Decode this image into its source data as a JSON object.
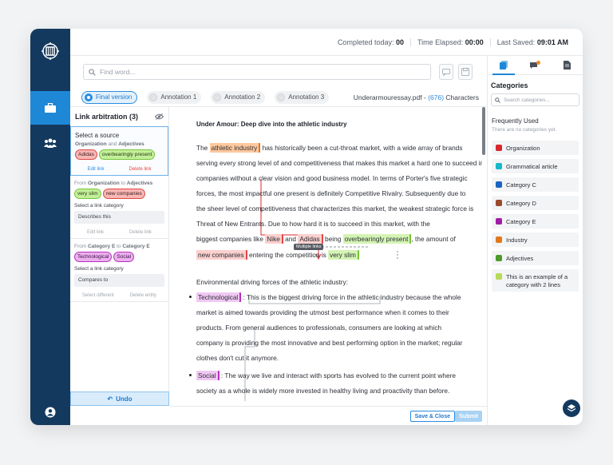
{
  "header": {
    "completed_label": "Completed today:",
    "completed_value": "00",
    "elapsed_label": "Time Elapsed:",
    "elapsed_value": "00:00",
    "saved_label": "Last Saved:",
    "saved_value": "09:01 AM"
  },
  "search": {
    "placeholder": "Find word..."
  },
  "versions": [
    "Final version",
    "Annotation 1",
    "Annotation 2",
    "Annotation 3"
  ],
  "file": {
    "name": "Underarmouressay.pdf",
    "sep": "-",
    "count": "(676)",
    "unit": "Characters"
  },
  "link_panel": {
    "title": "Link arbitration (3)",
    "cards": [
      {
        "heading": "Select a source",
        "from_a": "Organization",
        "from_mid": "and",
        "from_b": "Adjectives",
        "pills": [
          {
            "text": "Adidas",
            "cat": "red"
          },
          {
            "text": "overbearingly present",
            "cat": "green"
          }
        ],
        "act1": "Edit link",
        "act2": "Delete link"
      },
      {
        "from_pre": "From",
        "from_a": "Organization",
        "from_mid": "to",
        "from_b": "Adjectives",
        "pills": [
          {
            "text": "very slim",
            "cat": "green"
          },
          {
            "text": "new companies",
            "cat": "red"
          }
        ],
        "select_label": "Select a link category",
        "select_value": "Describes this",
        "act1": "Edit link",
        "act2": "Delete link"
      },
      {
        "from_pre": "From",
        "from_a": "Category E",
        "from_mid": "to",
        "from_b": "Category E",
        "pills": [
          {
            "text": "Technological",
            "cat": "purple"
          },
          {
            "text": "Social",
            "cat": "purple"
          }
        ],
        "select_label": "Select a link category",
        "select_value": "Compares to",
        "act1": "Select different",
        "act2": "Delete entity"
      }
    ],
    "undo": "Undo"
  },
  "document": {
    "title": "Under Amour: Deep dive into the athletic industry",
    "p1": {
      "l1_pre": "The",
      "l1_hl": "athletic industry",
      "l1_post": "has historically been a cut-throat market, with a wide array of brands",
      "l2": "serving every strong level of and competitiveness that makes this market a hard one to succeed in for",
      "l2_display": "serving every strong level of and competitiveness that makes this market a hard one to succeed in for",
      "l3": "companies without a clear vision and good business model. In terms of Porter's five strategic",
      "l4": "forces, the most impactful one present is definitely Competitive Rivalry. Subsequently due to",
      "l5": "the sheer level of competitiveness that characterizes this market, the weakest strategic force is",
      "l6": "Threat of New Entrants. Due to how hard it is to succeed in this market, with the",
      "l7_pre": "biggest companies like",
      "l7_nike": "Nike",
      "l7_and": "and",
      "l7_adidas": "Adidas",
      "l7_being": "being",
      "l7_hl": "overbearingly present",
      "l7_post": ", the amount of",
      "l8_hl1": "new companies",
      "l8_mid": "entering the competition is",
      "l8_hl2": "very slim"
    },
    "multiple_links": "Multiple links",
    "p2_heading": "Environmental driving forces of the athletic industry:",
    "b1": {
      "hl": "Technological",
      "l1": ": This is the biggest driving force in the athletic industry because the whole",
      "l2": "market is aimed towards providing the utmost best performance when it comes to their",
      "l3": "products. From general audiences to professionals, consumers are looking at which",
      "l4": "company is providing the most innovative and best performing option in the market; regular",
      "l5": "clothes don't cut it anymore."
    },
    "b2": {
      "hl": "Social",
      "l1": ": The way we live and interact with sports has evolved to the current point where",
      "l2": "society as a whole is widely more invested in healthy living and proactivity than before."
    }
  },
  "footer": {
    "save": "Save & Close",
    "submit": "Submit"
  },
  "categories": {
    "title": "Categories",
    "search_placeholder": "Search categories...",
    "frequent": "Frequently Used",
    "frequent_empty": "There are no categories yet.",
    "items": [
      {
        "label": "Organization",
        "color": "#d8282f"
      },
      {
        "label": "Grammatical article",
        "color": "#17b8c9"
      },
      {
        "label": "Category C",
        "color": "#1b63c2"
      },
      {
        "label": "Category D",
        "color": "#9a4a2c"
      },
      {
        "label": "Category E",
        "color": "#a01ca8"
      },
      {
        "label": "Industry",
        "color": "#e07820"
      },
      {
        "label": "Adjectives",
        "color": "#4f9b2a"
      },
      {
        "label": "This is an example of a category with 2 lines",
        "color": "#b7d95a"
      }
    ]
  },
  "colors": {
    "rail": "#14395e",
    "accent": "#1e88d6"
  },
  "icons": {
    "logo": "chip-logo-icon",
    "briefcase": "briefcase-icon",
    "people": "people-icon",
    "user": "user-icon",
    "search": "search-icon",
    "layers": "layers-icon"
  }
}
